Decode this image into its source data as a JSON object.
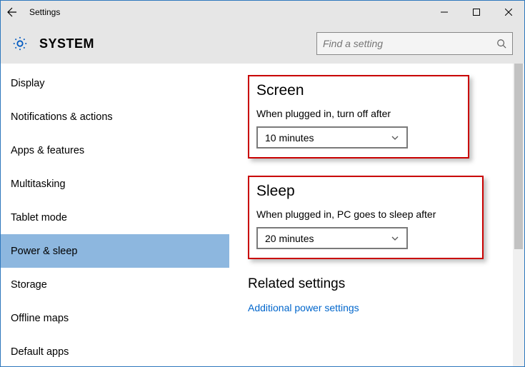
{
  "titlebar": {
    "title": "Settings"
  },
  "header": {
    "title": "SYSTEM",
    "search_placeholder": "Find a setting"
  },
  "sidebar": {
    "items": [
      {
        "label": "Display"
      },
      {
        "label": "Notifications & actions"
      },
      {
        "label": "Apps & features"
      },
      {
        "label": "Multitasking"
      },
      {
        "label": "Tablet mode"
      },
      {
        "label": "Power & sleep"
      },
      {
        "label": "Storage"
      },
      {
        "label": "Offline maps"
      },
      {
        "label": "Default apps"
      }
    ],
    "selected_index": 5
  },
  "main": {
    "screen": {
      "title": "Screen",
      "label": "When plugged in, turn off after",
      "value": "10 minutes"
    },
    "sleep": {
      "title": "Sleep",
      "label": "When plugged in, PC goes to sleep after",
      "value": "20 minutes"
    },
    "related": {
      "title": "Related settings",
      "link": "Additional power settings"
    }
  }
}
